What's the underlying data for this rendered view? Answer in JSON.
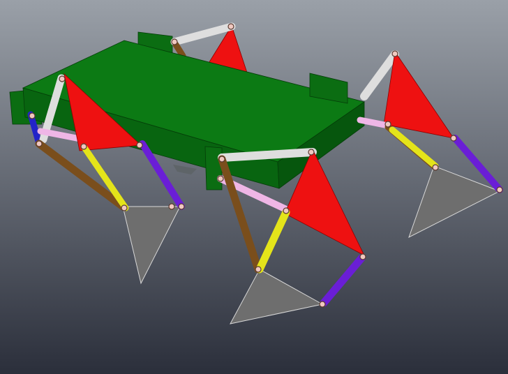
{
  "viewport": {
    "background_top": "#9aa0a8",
    "background_bottom": "#2b2f3b"
  },
  "colors": {
    "body_top": "#0c7a14",
    "body_front": "#086510",
    "body_side": "#06560d",
    "bracket": "#0b6d12",
    "crank_triangle": "#ee1111",
    "foot_triangle": "#6e6e6e",
    "link_white": "#dedede",
    "link_brown": "#7a4e1c",
    "link_yellow": "#e4e41a",
    "link_purple": "#6a1ed6",
    "link_pink": "#efb6e6",
    "link_blue": "#2323c8",
    "pin": "#f0c8c0"
  },
  "icons": {
    "robot": "mechanism-model-icon"
  }
}
